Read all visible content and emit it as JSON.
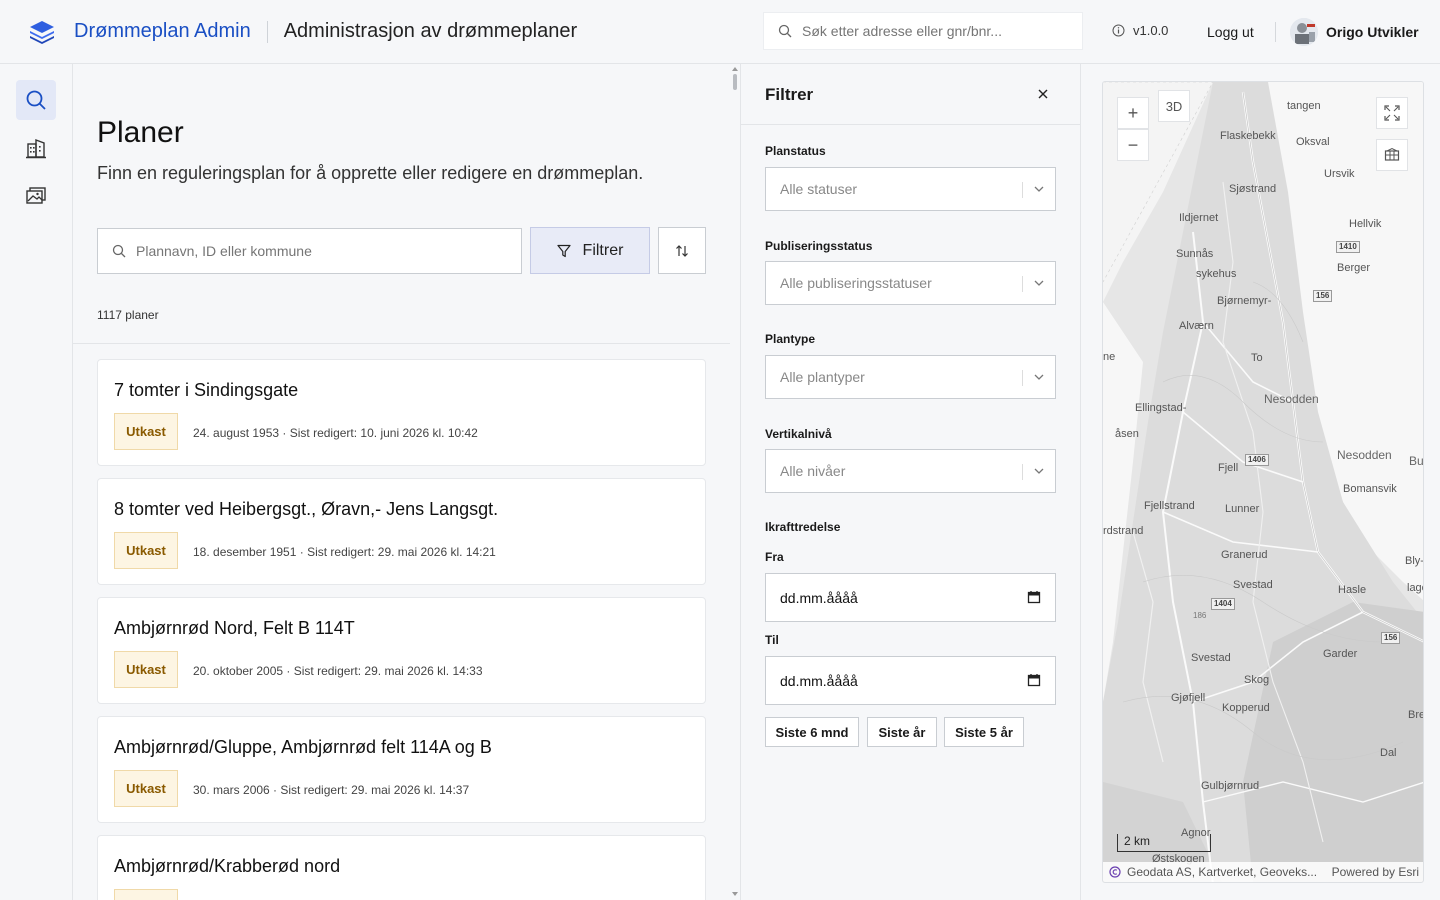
{
  "header": {
    "brand": "Drømmeplan Admin",
    "page_title": "Administrasjon av drømmeplaner",
    "search_placeholder": "Søk etter adresse eller gnr/bnr...",
    "version": "v1.0.0",
    "logout": "Logg ut",
    "user_name": "Origo Utvikler"
  },
  "rail": {
    "items": [
      {
        "icon": "search-icon",
        "active": true
      },
      {
        "icon": "building-icon",
        "active": false
      },
      {
        "icon": "images-icon",
        "active": false
      }
    ]
  },
  "main": {
    "title": "Planer",
    "subtitle": "Finn en reguleringsplan for å opprette eller redigere en drømmeplan.",
    "search_placeholder": "Plannavn, ID eller kommune",
    "filter_label": "Filtrer",
    "count": "1117 planer",
    "plans": [
      {
        "title": "7 tomter i Sindingsgate",
        "status": "Utkast",
        "meta": "24. august 1953 · Sist redigert: 10. juni 2026 kl. 10:42"
      },
      {
        "title": "8 tomter ved Heibergsgt., Øravn,- Jens Langsgt.",
        "status": "Utkast",
        "meta": "18. desember 1951 · Sist redigert: 29. mai 2026 kl. 14:21"
      },
      {
        "title": "Ambjørnrød Nord, Felt B 114T",
        "status": "Utkast",
        "meta": "20. oktober 2005 · Sist redigert: 29. mai 2026 kl. 14:33"
      },
      {
        "title": "Ambjørnrød/Gluppe, Ambjørnrød felt 114A og B",
        "status": "Utkast",
        "meta": "30. mars 2006 · Sist redigert: 29. mai 2026 kl. 14:37"
      },
      {
        "title": "Ambjørnrød/Krabberød nord",
        "status": "",
        "meta": ""
      }
    ]
  },
  "filter_panel": {
    "title": "Filtrer",
    "planstatus_label": "Planstatus",
    "planstatus_placeholder": "Alle statuser",
    "publisering_label": "Publiseringsstatus",
    "publisering_placeholder": "Alle publiseringsstatuser",
    "plantype_label": "Plantype",
    "plantype_placeholder": "Alle plantyper",
    "vertikal_label": "Vertikalnivå",
    "vertikal_placeholder": "Alle nivåer",
    "ikraft_label": "Ikrafttredelse",
    "fra_label": "Fra",
    "fra_value": "dd.mm.åååå",
    "til_label": "Til",
    "til_value": "dd.mm.åååå",
    "quick": [
      "Siste 6 mnd",
      "Siste år",
      "Siste 5 år"
    ]
  },
  "map": {
    "btn_3d": "3D",
    "zoom_in": "+",
    "zoom_out": "−",
    "scale": "2 km",
    "attribution": "Geodata AS, Kartverket, Geoveks...",
    "powered": "Powered by Esri",
    "labels": [
      "tangen",
      "Flaskebekk",
      "Oksval",
      "Ursvik",
      "Sjøstrand",
      "Ildjernet",
      "Hellvik",
      "Sunnås",
      "sykehus",
      "Berger",
      "Bjørnemyr-",
      "Alværn",
      "ne",
      "To",
      "Nesodden",
      "Ellingstad-",
      "åsen",
      "Nesodden",
      "Bu",
      "Fjell",
      "Bomansvik",
      "Fjellstrand",
      "Lunner",
      "rdstrand",
      "Granerud",
      "Bly-",
      "Svestad",
      "Hasle",
      "lage",
      "Svestad",
      "Garder",
      "Skog",
      "Gjøfjell",
      "Kopperud",
      "Bre",
      "Dal",
      "Gulbjørnrud",
      "Agnor",
      "Østskogen"
    ],
    "road_numbers": [
      "1410",
      "156",
      "1406",
      "1404",
      "156"
    ],
    "elevation": "186"
  }
}
